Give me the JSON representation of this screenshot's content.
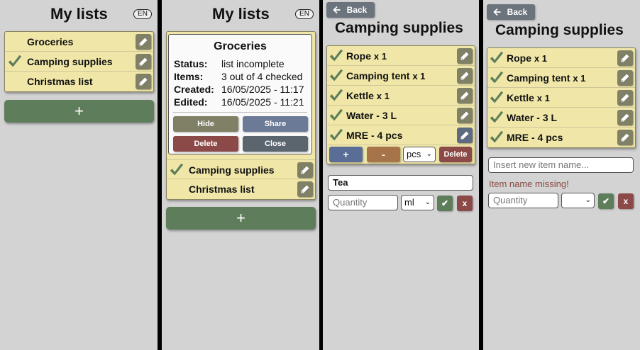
{
  "colors": {
    "list_bg": "#efe6a8",
    "accent_green": "#5e7d5a",
    "edit_button": "#808066",
    "edit_button_active": "#5d6a80",
    "delete_red": "#8b4a47",
    "share_blue": "#6b7a96",
    "close_gray": "#5a656e",
    "hide_olive": "#808066",
    "check_green": "#5c7d57"
  },
  "panel1": {
    "title": "My lists",
    "lang": "EN",
    "lists": [
      {
        "name": "Groceries",
        "checked": false
      },
      {
        "name": "Camping supplies",
        "checked": true
      },
      {
        "name": "Christmas list",
        "checked": false
      }
    ],
    "add_label": "+"
  },
  "panel2": {
    "title": "My lists",
    "lang": "EN",
    "card": {
      "title": "Groceries",
      "status_label": "Status:",
      "status_value": "list incomplete",
      "items_label": "Items:",
      "items_value": "3 out of 4 checked",
      "created_label": "Created:",
      "created_value": "16/05/2025 - 11:17",
      "edited_label": "Edited:",
      "edited_value": "16/05/2025 - 11:21",
      "hide": "Hide",
      "share": "Share",
      "delete": "Delete",
      "close": "Close"
    },
    "lists": [
      {
        "name": "Camping supplies",
        "checked": true
      },
      {
        "name": "Christmas list",
        "checked": false
      }
    ],
    "add_label": "+"
  },
  "panel3": {
    "back": "Back",
    "title": "Camping supplies",
    "items": [
      {
        "name": "Rope",
        "qty": "x 1"
      },
      {
        "name": "Camping tent",
        "qty": "x 1"
      },
      {
        "name": "Kettle",
        "qty": "x 1"
      },
      {
        "name": "Water - 3 L",
        "qty": ""
      },
      {
        "name": "MRE - 4 pcs",
        "qty": ""
      }
    ],
    "plus": "+",
    "minus": "-",
    "unit_selected": "pcs",
    "delete": "Delete",
    "item_input_value": "Tea",
    "quantity_placeholder": "Quantity",
    "quantity_unit": "ml",
    "confirm": "✔",
    "cancel": "x"
  },
  "panel4": {
    "back": "Back",
    "title": "Camping supplies",
    "items": [
      {
        "name": "Rope",
        "qty": "x 1"
      },
      {
        "name": "Camping tent",
        "qty": "x 1"
      },
      {
        "name": "Kettle",
        "qty": "x 1"
      },
      {
        "name": "Water - 3 L",
        "qty": ""
      },
      {
        "name": "MRE - 4 pcs",
        "qty": ""
      }
    ],
    "item_placeholder": "Insert new item name...",
    "error": "Item name missing!",
    "quantity_placeholder": "Quantity",
    "unit_selected": "",
    "confirm": "✔",
    "cancel": "x"
  }
}
